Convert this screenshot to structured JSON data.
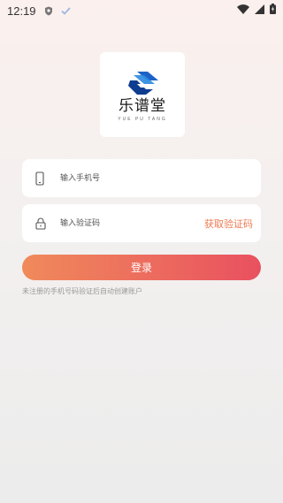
{
  "status_bar": {
    "time": "12:19"
  },
  "logo": {
    "title": "乐谱堂",
    "subtitle": "YUE PU TANG"
  },
  "login_form": {
    "phone_placeholder": "输入手机号",
    "code_placeholder": "输入验证码",
    "get_code_label": "获取验证码",
    "login_label": "登录",
    "tip": "未注册的手机号码验证后自动创建账户"
  },
  "colors": {
    "accent": "#ee7a52",
    "button_start": "#f08a5b",
    "button_end": "#e9505f",
    "logo_blue": "#1c63c8"
  },
  "icons": [
    "shield-icon",
    "check-icon",
    "wifi-icon",
    "signal-icon",
    "battery-icon",
    "phone-icon",
    "lock-icon"
  ]
}
